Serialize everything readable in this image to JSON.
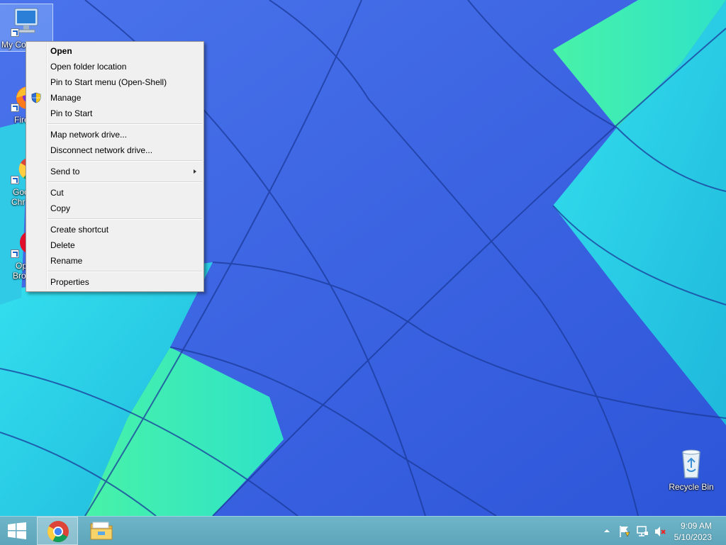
{
  "desktop": {
    "icons": [
      {
        "label": "My Co"
      },
      {
        "label": "Fire"
      },
      {
        "label": "Goo",
        "label2": "Chr"
      },
      {
        "label": "Op",
        "label2": "Bro"
      },
      {
        "label": "Recycle Bin"
      }
    ]
  },
  "context_menu": {
    "items": [
      {
        "label": "Open"
      },
      {
        "label": "Open folder location"
      },
      {
        "label": "Pin to Start menu (Open-Shell)"
      },
      {
        "label": "Manage",
        "icon": "shield-icon"
      },
      {
        "label": "Pin to Start"
      },
      {
        "label": "Map network drive..."
      },
      {
        "label": "Disconnect network drive..."
      },
      {
        "label": "Send to"
      },
      {
        "label": "Cut"
      },
      {
        "label": "Copy"
      },
      {
        "label": "Create shortcut"
      },
      {
        "label": "Delete"
      },
      {
        "label": "Rename"
      },
      {
        "label": "Properties"
      }
    ]
  },
  "taskbar": {
    "pinned": [
      {
        "icon": "windows-logo-icon"
      },
      {
        "icon": "chrome-icon"
      },
      {
        "icon": "file-explorer-icon"
      }
    ],
    "tray": {
      "icons": [
        "chevron-up-icon",
        "action-center-flag-icon",
        "network-icon",
        "volume-muted-icon"
      ]
    },
    "clock": {
      "time": "9:09 AM",
      "date": "5/10/2023"
    }
  },
  "colors": {
    "wallpaper_blue": "#3a63e6",
    "wallpaper_cyan": "#28d8e8",
    "wallpaper_green": "#3ff0b0",
    "taskbar": "#63aac0"
  }
}
